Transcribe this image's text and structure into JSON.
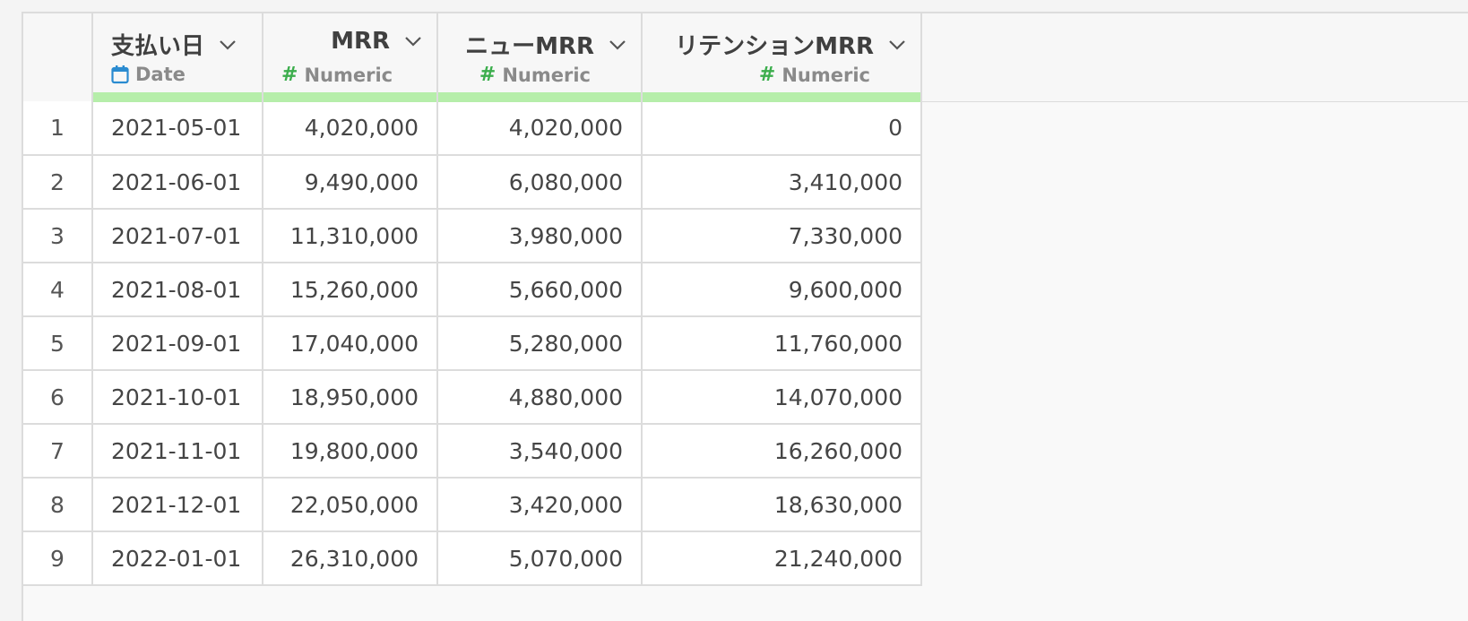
{
  "columns": [
    {
      "name": "支払い日",
      "type": "Date",
      "type_icon": "calendar-icon"
    },
    {
      "name": "MRR",
      "type": "Numeric",
      "type_icon": "hash-icon"
    },
    {
      "name": "ニューMRR",
      "type": "Numeric",
      "type_icon": "hash-icon"
    },
    {
      "name": "リテンションMRR",
      "type": "Numeric",
      "type_icon": "hash-icon"
    }
  ],
  "rows": [
    {
      "n": "1",
      "date": "2021-05-01",
      "mrr": "4,020,000",
      "new_mrr": "4,020,000",
      "retention_mrr": "0"
    },
    {
      "n": "2",
      "date": "2021-06-01",
      "mrr": "9,490,000",
      "new_mrr": "6,080,000",
      "retention_mrr": "3,410,000"
    },
    {
      "n": "3",
      "date": "2021-07-01",
      "mrr": "11,310,000",
      "new_mrr": "3,980,000",
      "retention_mrr": "7,330,000"
    },
    {
      "n": "4",
      "date": "2021-08-01",
      "mrr": "15,260,000",
      "new_mrr": "5,660,000",
      "retention_mrr": "9,600,000"
    },
    {
      "n": "5",
      "date": "2021-09-01",
      "mrr": "17,040,000",
      "new_mrr": "5,280,000",
      "retention_mrr": "11,760,000"
    },
    {
      "n": "6",
      "date": "2021-10-01",
      "mrr": "18,950,000",
      "new_mrr": "4,880,000",
      "retention_mrr": "14,070,000"
    },
    {
      "n": "7",
      "date": "2021-11-01",
      "mrr": "19,800,000",
      "new_mrr": "3,540,000",
      "retention_mrr": "16,260,000"
    },
    {
      "n": "8",
      "date": "2021-12-01",
      "mrr": "22,050,000",
      "new_mrr": "3,420,000",
      "retention_mrr": "18,630,000"
    },
    {
      "n": "9",
      "date": "2022-01-01",
      "mrr": "26,310,000",
      "new_mrr": "5,070,000",
      "retention_mrr": "21,240,000"
    }
  ],
  "colors": {
    "column_quality_bar": "#b6eeaa",
    "numeric_type": "#3cae4d",
    "date_type": "#2a8bd0",
    "grid_line": "#dcdcdc"
  }
}
